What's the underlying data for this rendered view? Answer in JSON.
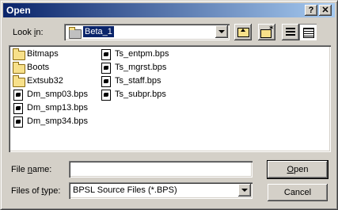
{
  "window": {
    "title": "Open",
    "help_glyph": "?",
    "close_glyph": "✕"
  },
  "lookin": {
    "label_pre": "Look ",
    "label_u": "i",
    "label_post": "n:",
    "value": "Beta_1"
  },
  "files": [
    {
      "name": "Bitmaps",
      "type": "folder"
    },
    {
      "name": "Boots",
      "type": "folder"
    },
    {
      "name": "Extsub32",
      "type": "folder"
    },
    {
      "name": "Dm_smp03.bps",
      "type": "doc"
    },
    {
      "name": "Dm_smp13.bps",
      "type": "doc"
    },
    {
      "name": "Dm_smp34.bps",
      "type": "doc"
    },
    {
      "name": "Ts_entpm.bps",
      "type": "doc"
    },
    {
      "name": "Ts_mgrst.bps",
      "type": "doc"
    },
    {
      "name": "Ts_staff.bps",
      "type": "doc"
    },
    {
      "name": "Ts_subpr.bps",
      "type": "doc"
    }
  ],
  "filename": {
    "label_pre": "File ",
    "label_u": "n",
    "label_post": "ame:",
    "value": ""
  },
  "filetype": {
    "label_pre": "Files of ",
    "label_u": "t",
    "label_post": "ype:",
    "value": "BPSL Source Files (*.BPS)"
  },
  "buttons": {
    "open_u": "O",
    "open_rest": "pen",
    "cancel": "Cancel"
  },
  "colors": {
    "title_start": "#0a246a",
    "title_end": "#a6caf0",
    "face": "#d4d0c8",
    "selection": "#0a246a"
  }
}
